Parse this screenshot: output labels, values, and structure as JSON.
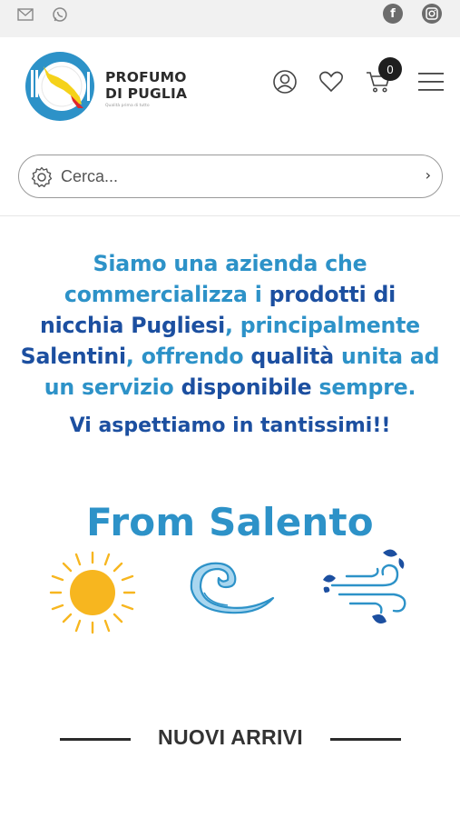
{
  "topbar": {
    "email_icon": "mail-icon",
    "whatsapp_icon": "whatsapp-icon",
    "facebook_icon": "facebook-icon",
    "facebook_glyph": "f",
    "instagram_icon": "instagram-icon",
    "background": "#f1f1f1"
  },
  "header": {
    "brand_line1": "PROFUMO",
    "brand_line2": "DI PUGLIA",
    "brand_tagline": "Qualità prima di tutto",
    "account_icon": "user-icon",
    "wishlist_icon": "heart-icon",
    "cart_icon": "cart-icon",
    "cart_count": "0",
    "menu_icon": "hamburger-menu-icon"
  },
  "search": {
    "placeholder": "Cerca...",
    "icon": "gear-icon",
    "submit_glyph": "›"
  },
  "intro": {
    "line1_a": "Siamo una azienda che",
    "line2_a": "commercializza i ",
    "line2_b": "prodotti di",
    "line3_a": "nicchia Pugliesi",
    "line3_b": ", principalmente",
    "line4_a": "Salentini",
    "line4_b": ", offrendo ",
    "line4_c": "qualità",
    "line4_d": " unita ad",
    "line5_a": "un servizio ",
    "line5_b": "disponibile",
    "line5_c": " sempre.",
    "welcome": "Vi aspettiamo in tantissimi!!"
  },
  "salento": {
    "title": "From Salento",
    "icons": [
      "sun-icon",
      "wave-icon",
      "wind-icon"
    ]
  },
  "arrivals": {
    "title": "NUOVI ARRIVI"
  },
  "colors": {
    "accent_light": "#2d92c8",
    "accent_dark": "#1c4fa0",
    "sun": "#f7b61f",
    "text_dark": "#2b2b2b"
  }
}
